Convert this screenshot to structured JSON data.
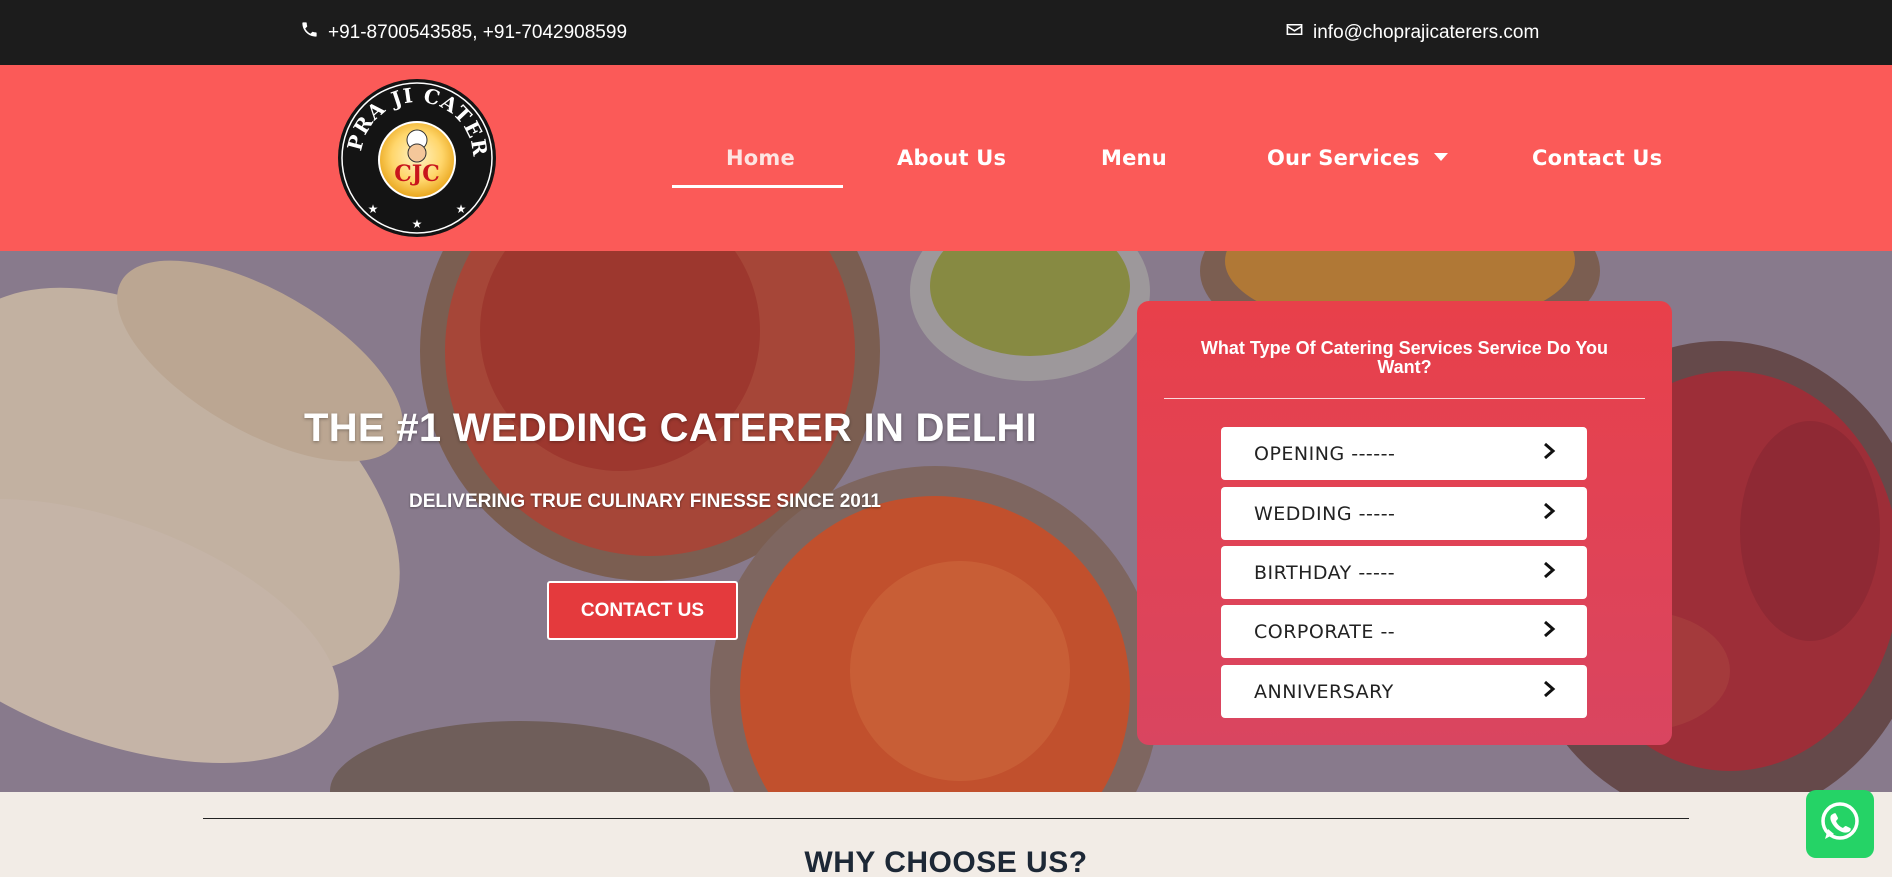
{
  "topbar": {
    "phone": "+91-8700543585, +91-7042908599",
    "email": "info@choprajicaterers.com",
    "icons": [
      "phone-icon",
      "envelope-icon"
    ]
  },
  "header": {
    "logo": {
      "ring_text": "CHOPRA JI CATERERS",
      "badge_text": "CJC"
    },
    "nav": [
      {
        "label": "Home",
        "active": true
      },
      {
        "label": "About Us"
      },
      {
        "label": "Menu"
      },
      {
        "label": "Our Services",
        "has_dropdown": true
      },
      {
        "label": "Contact Us"
      }
    ],
    "background_color": "#fb5a58"
  },
  "hero": {
    "title": "THE #1 WEDDING CATERER IN DELHI",
    "subtitle": "DELIVERING TRUE CULINARY FINESSE SINCE 2011",
    "cta_label": "CONTACT US",
    "cta_color": "#e43a3d"
  },
  "services_card": {
    "title": "What Type Of Catering Services Service Do You Want?",
    "options": [
      {
        "label": "OPENING ------"
      },
      {
        "label": "WEDDING -----"
      },
      {
        "label": "BIRTHDAY -----"
      },
      {
        "label": "CORPORATE --"
      },
      {
        "label": "ANNIVERSARY"
      }
    ],
    "color": "#e8404a"
  },
  "section": {
    "heading": "WHY CHOOSE US?"
  },
  "whatsapp": {
    "icon": "whatsapp-icon",
    "color": "#25d366"
  }
}
